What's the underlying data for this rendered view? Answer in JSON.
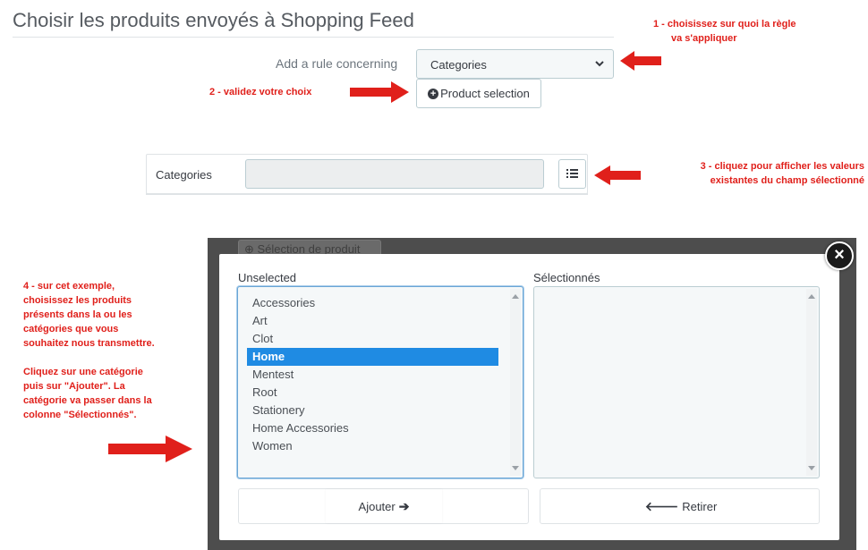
{
  "header": {
    "title": "Choisir les produits envoyés à Shopping Feed"
  },
  "rule": {
    "label": "Add a rule concerning",
    "select_value": "Categories",
    "product_selection_button": "Product selection"
  },
  "field": {
    "label": "Categories",
    "value": ""
  },
  "annotations": {
    "step1_line1": "1 - choisissez sur quoi la règle",
    "step1_line2": "va s'appliquer",
    "step2": "2 - validez votre choix",
    "step3_line1": "3 - cliquez pour afficher les valeurs",
    "step3_line2": "existantes du champ sélectionné",
    "step4_line1": "4 - sur cet exemple,",
    "step4_line2": "choisissez les produits",
    "step4_line3": "présents dans la ou les",
    "step4_line4": "catégories que vous",
    "step4_line5": "souhaitez nous transmettre.",
    "step4_line6": "Cliquez sur une catégorie",
    "step4_line7": "puis sur \"Ajouter\". La",
    "step4_line8": "catégorie va passer dans la",
    "step4_line9": "colonne \"Sélectionnés\"."
  },
  "modal": {
    "background_button": "Sélection de produit",
    "close_label": "×",
    "unselected_label": "Unselected",
    "selected_label": "Sélectionnés",
    "unselected_items": [
      "Accessories",
      "Art",
      "Clot",
      "Home",
      "Mentest",
      "Root",
      "Stationery",
      "Home Accessories",
      "Women"
    ],
    "selected_item": "Home",
    "selected_items": [],
    "add_button": "Ajouter",
    "remove_button": "Retirer"
  },
  "colors": {
    "annotation": "#e0201b",
    "highlight": "#1f8be3",
    "backdrop": "#4d4d4d"
  },
  "icons": {
    "select_chevron": "chevron-down-icon",
    "product_selection": "plus-circle-icon",
    "list_button": "list-icon",
    "close": "close-icon",
    "add": "arrow-right-icon",
    "remove": "arrow-left-icon",
    "pointer_arrows": "red-arrow-icon"
  }
}
